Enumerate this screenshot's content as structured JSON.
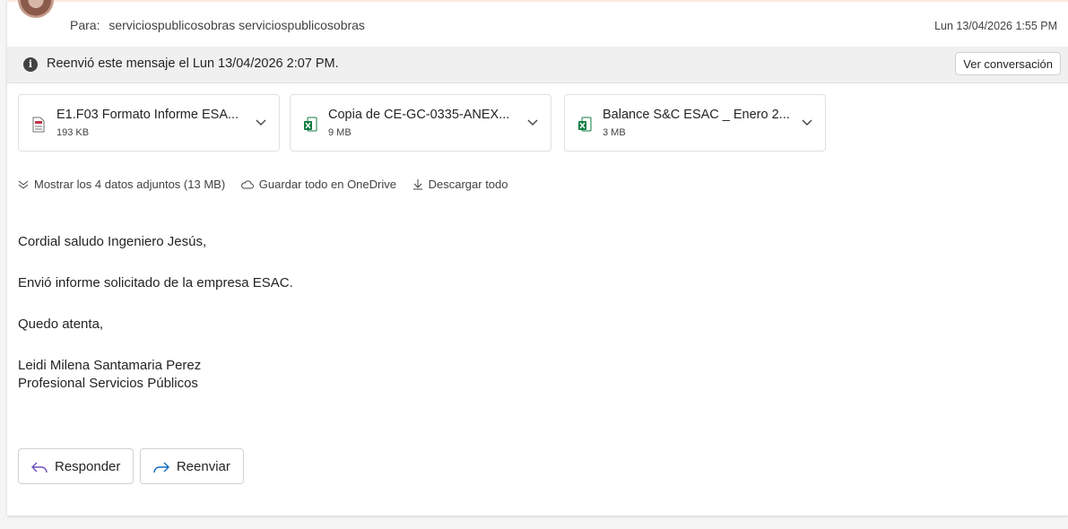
{
  "header": {
    "to_label": "Para:",
    "to_value": "serviciospublicosobras serviciospublicosobras",
    "date": "Lun 13/04/2026 1:55 PM"
  },
  "forward_bar": {
    "text": "Reenvió este mensaje el Lun 13/04/2026 2:07 PM.",
    "conversation_button": "Ver conversación"
  },
  "attachments": [
    {
      "name": "E1.F03 Formato Informe ESA...",
      "size": "193 KB",
      "icon": "pdf-file-icon"
    },
    {
      "name": "Copia de CE-GC-0335-ANEX...",
      "size": "9 MB",
      "icon": "excel-file-icon"
    },
    {
      "name": "Balance S&C ESAC _ Enero 2...",
      "size": "3 MB",
      "icon": "excel-file-icon"
    }
  ],
  "attachment_actions": {
    "show_all": "Mostrar los 4 datos adjuntos (13 MB)",
    "save_onedrive": "Guardar todo en OneDrive",
    "download_all": "Descargar todo"
  },
  "body": {
    "greeting": "Cordial saludo Ingeniero Jesús,",
    "paragraph": "Envió informe solicitado de la empresa ESAC.",
    "closing": "Quedo atenta,",
    "signature_name": "Leidi Milena Santamaria Perez",
    "signature_title": "Profesional Servicios Públicos"
  },
  "actions": {
    "reply": "Responder",
    "forward": "Reenviar"
  },
  "colors": {
    "accent": "#0f6cbd",
    "excel_green": "#107c41",
    "pdf_red": "#c4314b"
  }
}
